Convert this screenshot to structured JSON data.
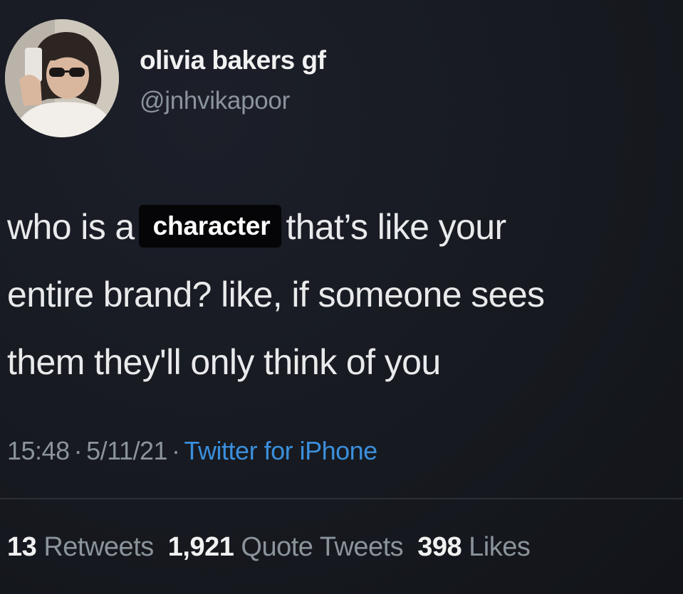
{
  "user": {
    "display_name": "olivia bakers gf",
    "handle": "@jnhvikapoor"
  },
  "tweet": {
    "line1_before": "who is a",
    "highlight": "character",
    "line1_after": "that’s like your",
    "line2": "entire brand? like, if someone sees",
    "line3": "them they'll only think of you"
  },
  "meta": {
    "time": "15:48",
    "date": "5/11/21",
    "separator": "·",
    "source": "Twitter for iPhone"
  },
  "stats": {
    "retweets_count": "13",
    "retweets_label": "Retweets",
    "quote_count": "1,921",
    "quote_label": "Quote Tweets",
    "likes_count": "398",
    "likes_label": "Likes"
  },
  "colors": {
    "background": "#16191f",
    "link": "#3a8fdc",
    "muted": "#8b939b"
  }
}
